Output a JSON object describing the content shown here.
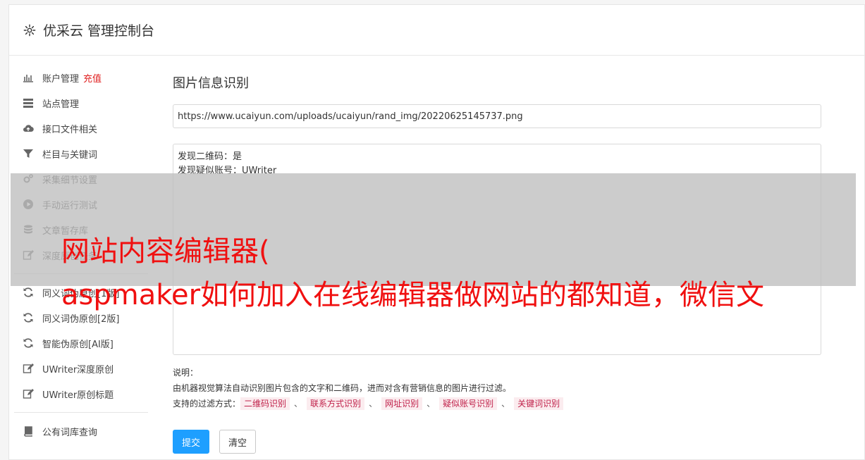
{
  "header": {
    "title": "优采云 管理控制台"
  },
  "sidebar": {
    "items": [
      {
        "label": "账户管理",
        "badge": "充值",
        "icon": "bar-chart-icon"
      },
      {
        "label": "站点管理",
        "icon": "server-icon"
      },
      {
        "label": "接口文件相关",
        "icon": "cloud-upload-icon"
      },
      {
        "label": "栏目与关键词",
        "icon": "filter-icon"
      },
      {
        "label": "采集细节设置",
        "icon": "gears-icon"
      },
      {
        "label": "手动运行测试",
        "icon": "play-circle-icon"
      },
      {
        "label": "文章暂存库",
        "icon": "database-icon"
      },
      {
        "label": "深度原创任务",
        "icon": "edit-icon"
      }
    ],
    "items2": [
      {
        "label": "同义词伪原创[1版]",
        "icon": "refresh-icon"
      },
      {
        "label": "同义词伪原创[2版]",
        "icon": "refresh-icon"
      },
      {
        "label": "智能伪原创[AI版]",
        "icon": "refresh-icon"
      },
      {
        "label": "UWriter深度原创",
        "icon": "edit-icon"
      },
      {
        "label": "UWriter原创标题",
        "icon": "edit-icon"
      }
    ],
    "items3": [
      {
        "label": "公有词库查询",
        "icon": "book-icon"
      }
    ]
  },
  "main": {
    "title": "图片信息识别",
    "url_value": "https://www.ucaiyun.com/uploads/ucaiyun/rand_img/20220625145737.png",
    "result_lines": [
      "发现二维码：是",
      "发现疑似账号：UWriter"
    ],
    "desc_title": "说明：",
    "desc_text": "由机器视觉算法自动识别图片包含的文字和二维码，进而对含有营销信息的图片进行过滤。",
    "filter_label": "支持的过滤方式：",
    "filters": [
      "二维码识别",
      "联系方式识别",
      "网址识别",
      "疑似账号识别",
      "关键词识别"
    ],
    "filter_sep": "、",
    "submit_label": "提交",
    "clear_label": "清空"
  },
  "overlay": {
    "text": "网站内容编辑器(\naspmaker如何加入在线编辑器做网站的都知道，微信文"
  }
}
